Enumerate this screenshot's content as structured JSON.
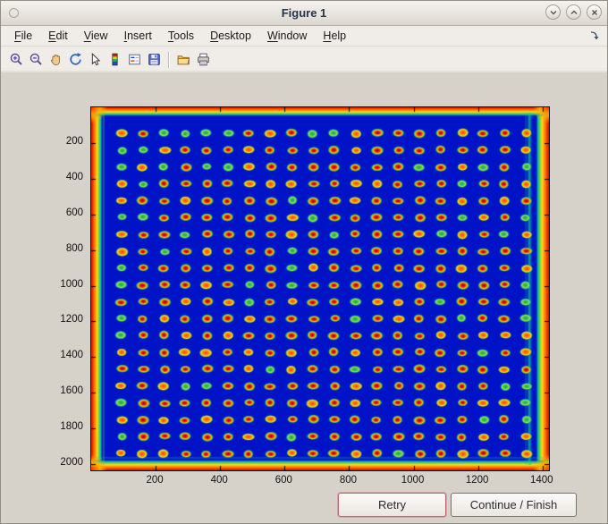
{
  "window": {
    "title": "Figure 1"
  },
  "menubar": {
    "items": [
      "File",
      "Edit",
      "View",
      "Insert",
      "Tools",
      "Desktop",
      "Window",
      "Help"
    ]
  },
  "toolbar": {
    "icons": [
      "zoom-in",
      "zoom-out",
      "pan",
      "rotate-3d",
      "edit-plot",
      "colorbar",
      "legend",
      "save",
      "open-folder",
      "print"
    ]
  },
  "plot": {
    "x_ticks": [
      200,
      400,
      600,
      800,
      1000,
      1200,
      1400
    ],
    "y_ticks": [
      200,
      400,
      600,
      800,
      1000,
      1200,
      1400,
      1600,
      1800,
      2000
    ],
    "x_range": [
      0,
      1420
    ],
    "y_range": [
      0,
      2035
    ],
    "grid_rows": 20,
    "grid_cols": 20,
    "bg_color": "#0013c6",
    "spot_core_color": "#900000",
    "spot_hot_color": "#ff5a00",
    "spot_ring_color": "#ffc81e",
    "spot_halo_color": "#46c83c",
    "edge_hot_color": "#ff3c00"
  },
  "actions": {
    "retry": "Retry",
    "continue": "Continue / Finish"
  }
}
